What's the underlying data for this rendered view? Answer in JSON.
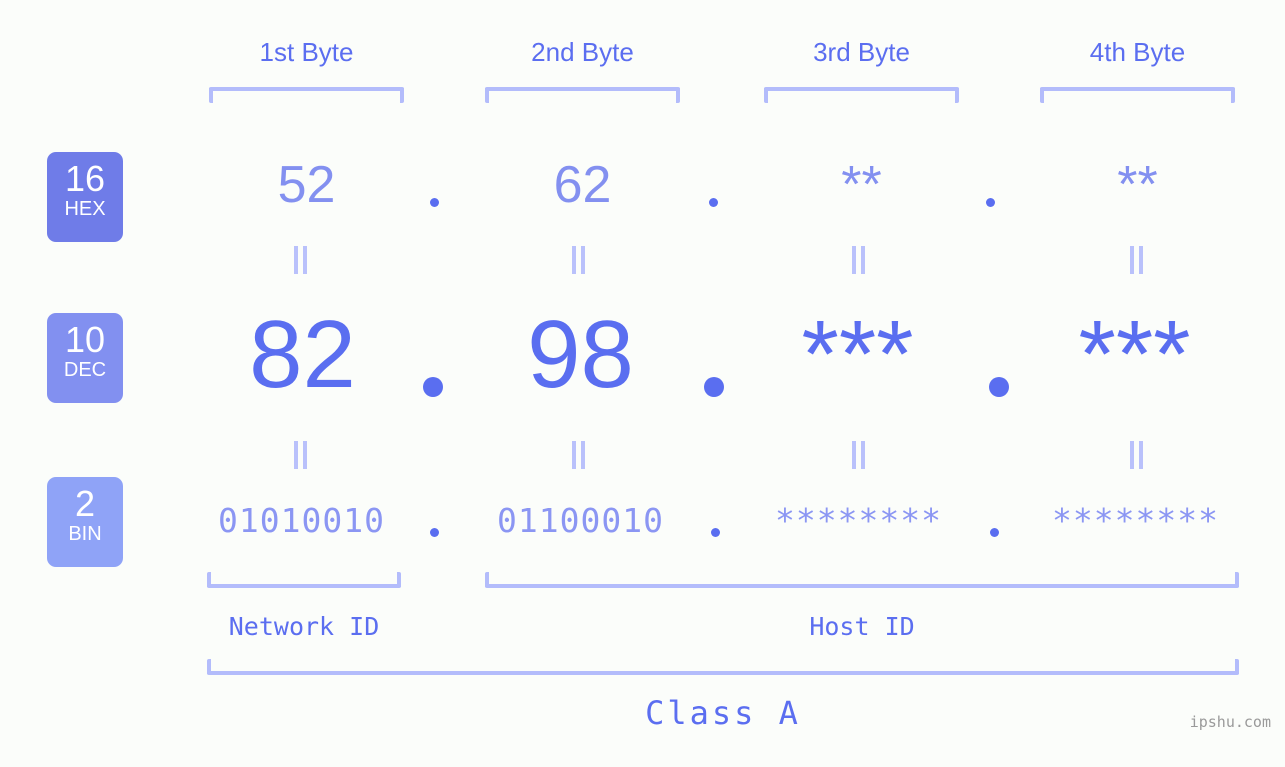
{
  "background": "#fbfdfa",
  "accent": "#5a6ef0",
  "accent_light": "#8390f0",
  "bracket_color": "#b3bcfb",
  "byte_headers": [
    {
      "label": "1st Byte"
    },
    {
      "label": "2nd Byte"
    },
    {
      "label": "3rd Byte"
    },
    {
      "label": "4th Byte"
    }
  ],
  "radix_badges": [
    {
      "number": "16",
      "name": "HEX",
      "color": "#6f7ce8"
    },
    {
      "number": "10",
      "name": "DEC",
      "color": "#8290f0"
    },
    {
      "number": "2",
      "name": "BIN",
      "color": "#8fa3f7"
    }
  ],
  "rows": {
    "hex": {
      "octets": [
        "52",
        "62",
        "**",
        "**"
      ],
      "separator": "."
    },
    "dec": {
      "octets": [
        "82",
        "98",
        "***",
        "***"
      ],
      "separator": "."
    },
    "bin": {
      "octets": [
        "01010010",
        "01100010",
        "********",
        "********"
      ],
      "separator": "."
    }
  },
  "equals_symbol": "=",
  "sections": [
    {
      "label": "Network ID"
    },
    {
      "label": "Host ID"
    }
  ],
  "class": {
    "label": "Class A"
  },
  "watermark": {
    "text": "ipshu.com"
  }
}
